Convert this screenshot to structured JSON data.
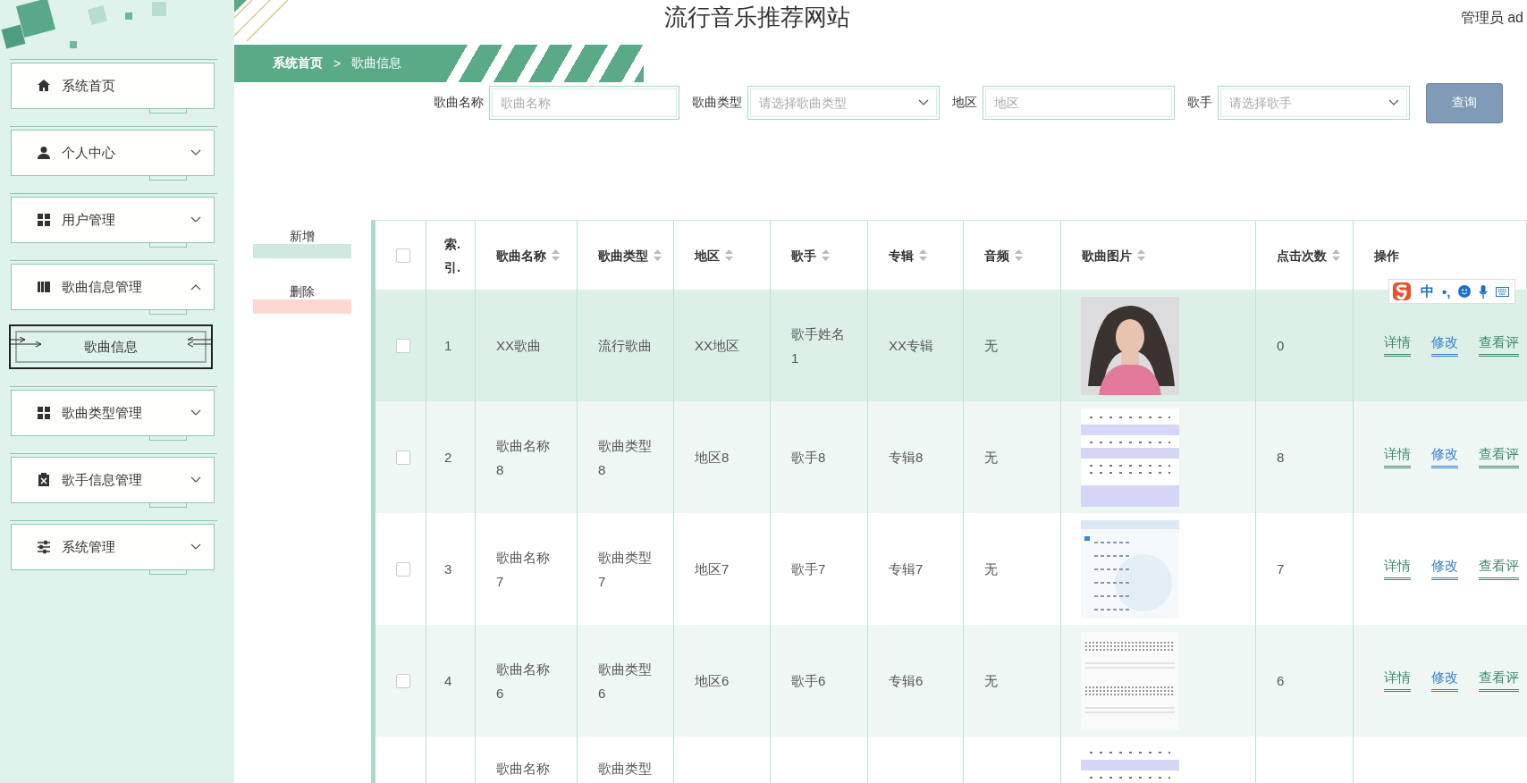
{
  "site_title": "流行音乐推荐网站",
  "user": "管理员 ad",
  "sidebar": {
    "items": [
      {
        "label": "系统首页",
        "kind": "link"
      },
      {
        "label": "个人中心",
        "kind": "group",
        "expanded": false
      },
      {
        "label": "用户管理",
        "kind": "group",
        "expanded": false
      },
      {
        "label": "歌曲信息管理",
        "kind": "group",
        "expanded": true,
        "children": [
          {
            "label": "歌曲信息",
            "selected": true
          }
        ]
      },
      {
        "label": "歌曲类型管理",
        "kind": "group",
        "expanded": false
      },
      {
        "label": "歌手信息管理",
        "kind": "group",
        "expanded": false
      },
      {
        "label": "系统管理",
        "kind": "group",
        "expanded": false
      }
    ]
  },
  "breadcrumb": {
    "items": [
      "系统首页",
      "歌曲信息"
    ],
    "separator": ">"
  },
  "search": {
    "fields": [
      {
        "label": "歌曲名称",
        "placeholder": "歌曲名称",
        "kind": "input"
      },
      {
        "label": "歌曲类型",
        "placeholder": "请选择歌曲类型",
        "kind": "select"
      },
      {
        "label": "地区",
        "placeholder": "地区",
        "kind": "input"
      },
      {
        "label": "歌手",
        "placeholder": "请选择歌手",
        "kind": "select"
      }
    ],
    "button": "查询"
  },
  "actions": [
    {
      "label": "新增",
      "kind": "add"
    },
    {
      "label": "删除",
      "kind": "delete"
    }
  ],
  "table": {
    "columns": [
      {
        "kind": "checkbox",
        "checked": false
      },
      {
        "kind": "text",
        "label": "索.引.",
        "sortable": false
      },
      {
        "kind": "text",
        "label": "歌曲名称",
        "sortable": true
      },
      {
        "kind": "text",
        "label": "歌曲类型",
        "sortable": true
      },
      {
        "kind": "text",
        "label": "地区",
        "sortable": true
      },
      {
        "kind": "text",
        "label": "歌手",
        "sortable": true
      },
      {
        "kind": "text",
        "label": "专辑",
        "sortable": true
      },
      {
        "kind": "text",
        "label": "音频",
        "sortable": true
      },
      {
        "kind": "text",
        "label": "歌曲图片",
        "sortable": true
      },
      {
        "kind": "text",
        "label": "点击次数",
        "sortable": true
      },
      {
        "kind": "text",
        "label": "操作",
        "sortable": false
      }
    ],
    "rows": [
      {
        "checked": false,
        "hovered": true,
        "cells": [
          "",
          "1",
          "XX歌曲",
          "流行歌曲",
          "XX地区",
          "歌手姓名1",
          "XX专辑",
          "无",
          "",
          "0"
        ],
        "image": {
          "kind": "picture"
        },
        "actions": [
          {
            "label": "详情",
            "kind": "detail"
          },
          {
            "label": "修改",
            "kind": "edit"
          },
          {
            "label": "查看评",
            "kind": "comments"
          }
        ]
      },
      {
        "checked": false,
        "hovered": false,
        "cells": [
          "",
          "2",
          "歌曲名称8",
          "歌曲类型8",
          "地区8",
          "歌手8",
          "专辑8",
          "无",
          "",
          "8"
        ],
        "image": {
          "kind": "picture"
        },
        "actions": [
          {
            "label": "详情",
            "kind": "detail"
          },
          {
            "label": "修改",
            "kind": "edit"
          },
          {
            "label": "查看评",
            "kind": "comments"
          }
        ]
      },
      {
        "checked": false,
        "hovered": false,
        "cells": [
          "",
          "3",
          "歌曲名称7",
          "歌曲类型7",
          "地区7",
          "歌手7",
          "专辑7",
          "无",
          "",
          "7"
        ],
        "image": {
          "kind": "picture"
        },
        "actions": [
          {
            "label": "详情",
            "kind": "detail"
          },
          {
            "label": "修改",
            "kind": "edit"
          },
          {
            "label": "查看评",
            "kind": "comments"
          }
        ]
      },
      {
        "checked": false,
        "hovered": false,
        "cells": [
          "",
          "4",
          "歌曲名称6",
          "歌曲类型6",
          "地区6",
          "歌手6",
          "专辑6",
          "无",
          "",
          "6"
        ],
        "image": {
          "kind": "picture"
        },
        "actions": [
          {
            "label": "详情",
            "kind": "detail"
          },
          {
            "label": "修改",
            "kind": "edit"
          },
          {
            "label": "查看评",
            "kind": "comments"
          }
        ]
      },
      {
        "hovered": false,
        "cells": [
          "",
          "",
          "歌曲名称",
          "歌曲类型"
        ],
        "image": {
          "kind": "picture"
        }
      }
    ]
  },
  "ime_toolbar": {
    "mode": "中",
    "punctuation": "•,"
  }
}
